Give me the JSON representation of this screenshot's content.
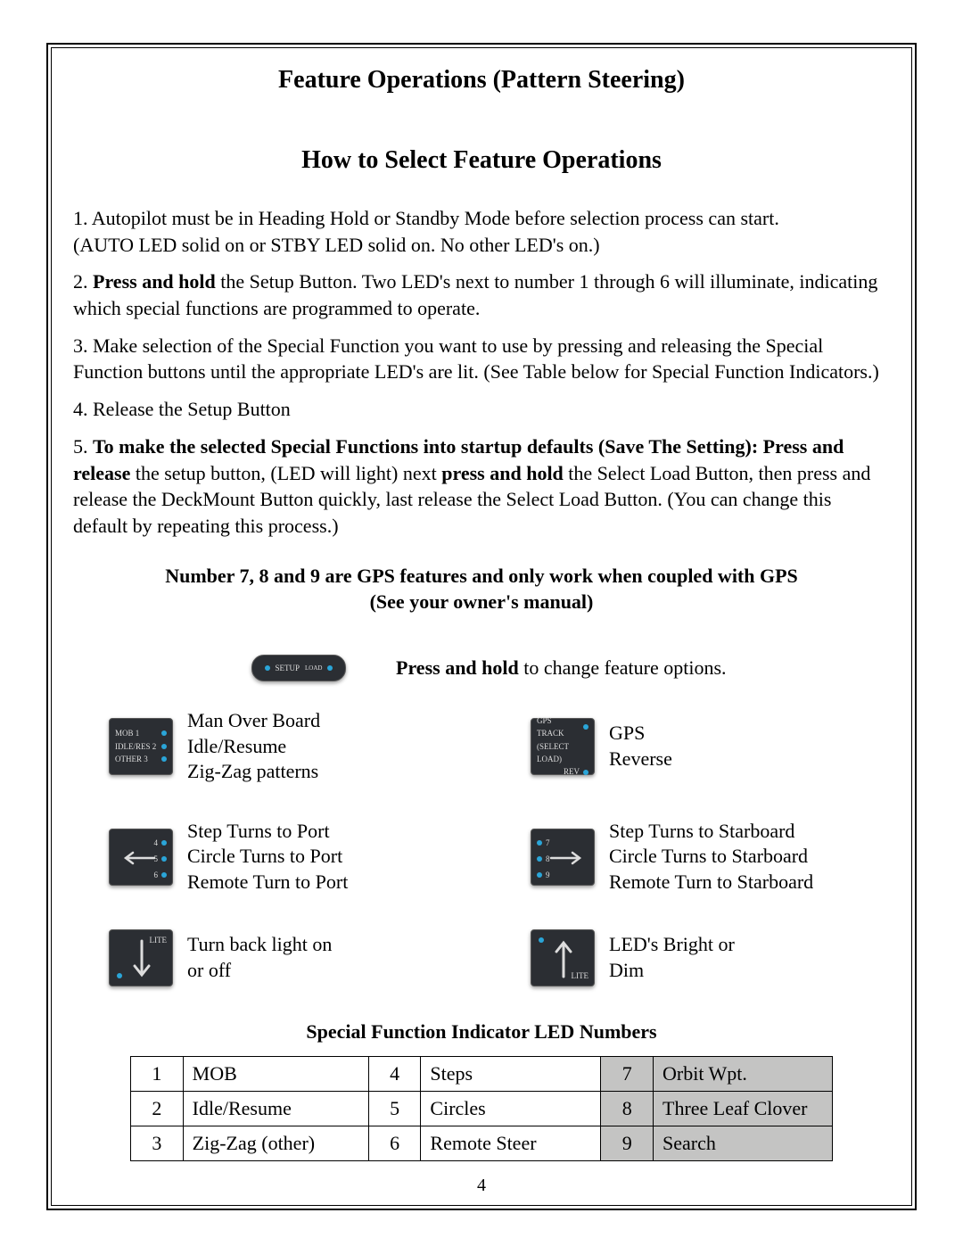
{
  "title": "Feature Operations (Pattern Steering)",
  "subtitle": "How to Select Feature Operations",
  "steps": {
    "s1a": "1.  Autopilot must be in Heading Hold or Standby Mode before selection process can start.",
    "s1b": "(AUTO LED solid on or STBY LED solid on.  No other LED's on.)",
    "s2_pre": "2.  ",
    "s2_bold": "Press and hold",
    "s2_post": " the Setup Button.  Two LED's next to number 1 through 6 will illuminate, indicating which  special functions are programmed to operate.",
    "s3": "3.  Make selection of the Special Function you want to use by pressing and releasing the Special Function buttons until the appropriate LED's are lit.  (See Table below for Special Function Indicators.)",
    "s4": "4.  Release the Setup Button",
    "s5_pre": "5.  ",
    "s5_bold": "To make the selected Special Functions into startup defaults (Save The Setting):   Press and release",
    "s5_post1": " the setup button, (LED will light) next ",
    "s5_bold2": "press and hold",
    "s5_post2": " the Select Load Button, then press and release the DeckMount Button quickly, last release the Select Load Button.  (You can change this default by repeating this process.)"
  },
  "gps_note_l1": "Number 7, 8 and 9 are GPS features and only work when coupled with GPS",
  "gps_note_l2": "(See your owner's manual)",
  "setup_bold": "Press and hold",
  "setup_rest": " to change feature options.",
  "setup_label": "SETUP",
  "setup_label2": "LOAD",
  "panels": {
    "p1": {
      "l1": "Man Over Board",
      "l2": "Idle/Resume",
      "l3": "Zig-Zag patterns",
      "i1": "MOB   1",
      "i2": "IDLE/RES 2",
      "i3": "OTHER  3"
    },
    "p2": {
      "l1": "GPS",
      "l2": "Reverse",
      "i1": "GPS TRACK",
      "i2": "(SELECT LOAD)",
      "i3": "REV"
    },
    "p3": {
      "l1": "Step Turns to Port",
      "l2": "Circle Turns to Port",
      "l3": "Remote Turn to Port",
      "i1": "4",
      "i2": "5",
      "i3": "6"
    },
    "p4": {
      "l1": "Step Turns to Starboard",
      "l2": "Circle Turns to Starboard",
      "l3": "Remote Turn to Starboard",
      "i1": "7",
      "i2": "8",
      "i3": "9"
    },
    "p5": {
      "l1": "Turn back light on",
      "l2": "or off",
      "i1": "LITE"
    },
    "p6": {
      "l1": "LED's Bright or",
      "l2": "Dim",
      "i1": "LITE"
    }
  },
  "table_title": "Special Function Indicator LED Numbers",
  "table": {
    "r1": {
      "n1": "1",
      "v1": "MOB",
      "n2": "4",
      "v2": "Steps",
      "n3": "7",
      "v3": "Orbit Wpt."
    },
    "r2": {
      "n1": "2",
      "v1": "Idle/Resume",
      "n2": "5",
      "v2": "Circles",
      "n3": "8",
      "v3": "Three Leaf Clover"
    },
    "r3": {
      "n1": "3",
      "v1": "Zig-Zag (other)",
      "n2": "6",
      "v2": "Remote Steer",
      "n3": "9",
      "v3": "Search"
    }
  },
  "page_number": "4"
}
